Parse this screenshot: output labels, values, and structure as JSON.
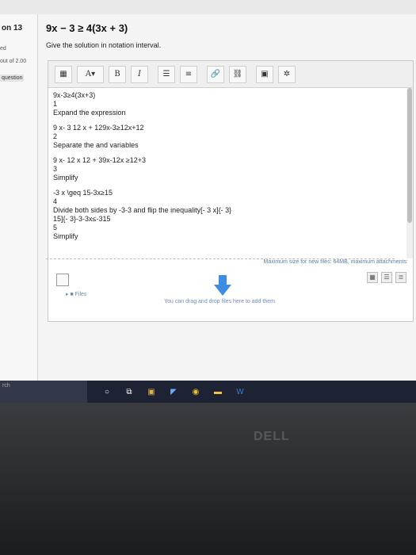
{
  "question_info": {
    "number": "on 13",
    "state": "ed",
    "mark": "out of 2.00",
    "flag": "question"
  },
  "question": {
    "title": "9x − 3 ≥ 4(3x + 3)",
    "prompt": "Give the solution in notation interval."
  },
  "toolbar": {
    "buttons": [
      "A",
      "B",
      "I"
    ]
  },
  "answer_lines": [
    "9x-3≥4(3x+3)",
    "1",
    "Expand the expression",
    "",
    "9 x- 3  12 x + 129x-3≥12x+12",
    "2",
    "Separate the  and variables",
    "",
    "9 x- 12 x  12 + 39x-12x ≥12+3",
    "3",
    "Simplify",
    "",
    "-3 x \\geq 15-3x≥15",
    "4",
    "Divide both sides by -3-3 and flip the inequality[- 3 x]{- 3}",
    "15]{- 3}-3-3x≤-315",
    "5",
    "Simplify"
  ],
  "filepicker": {
    "max_size": "Maximum size for new files: 64MB, maximum attachments:",
    "folder_label": "Files",
    "drop_text": "You can drag and drop files here to add them."
  },
  "taskbar": {
    "search_text": "rch"
  },
  "brand": "DELL"
}
